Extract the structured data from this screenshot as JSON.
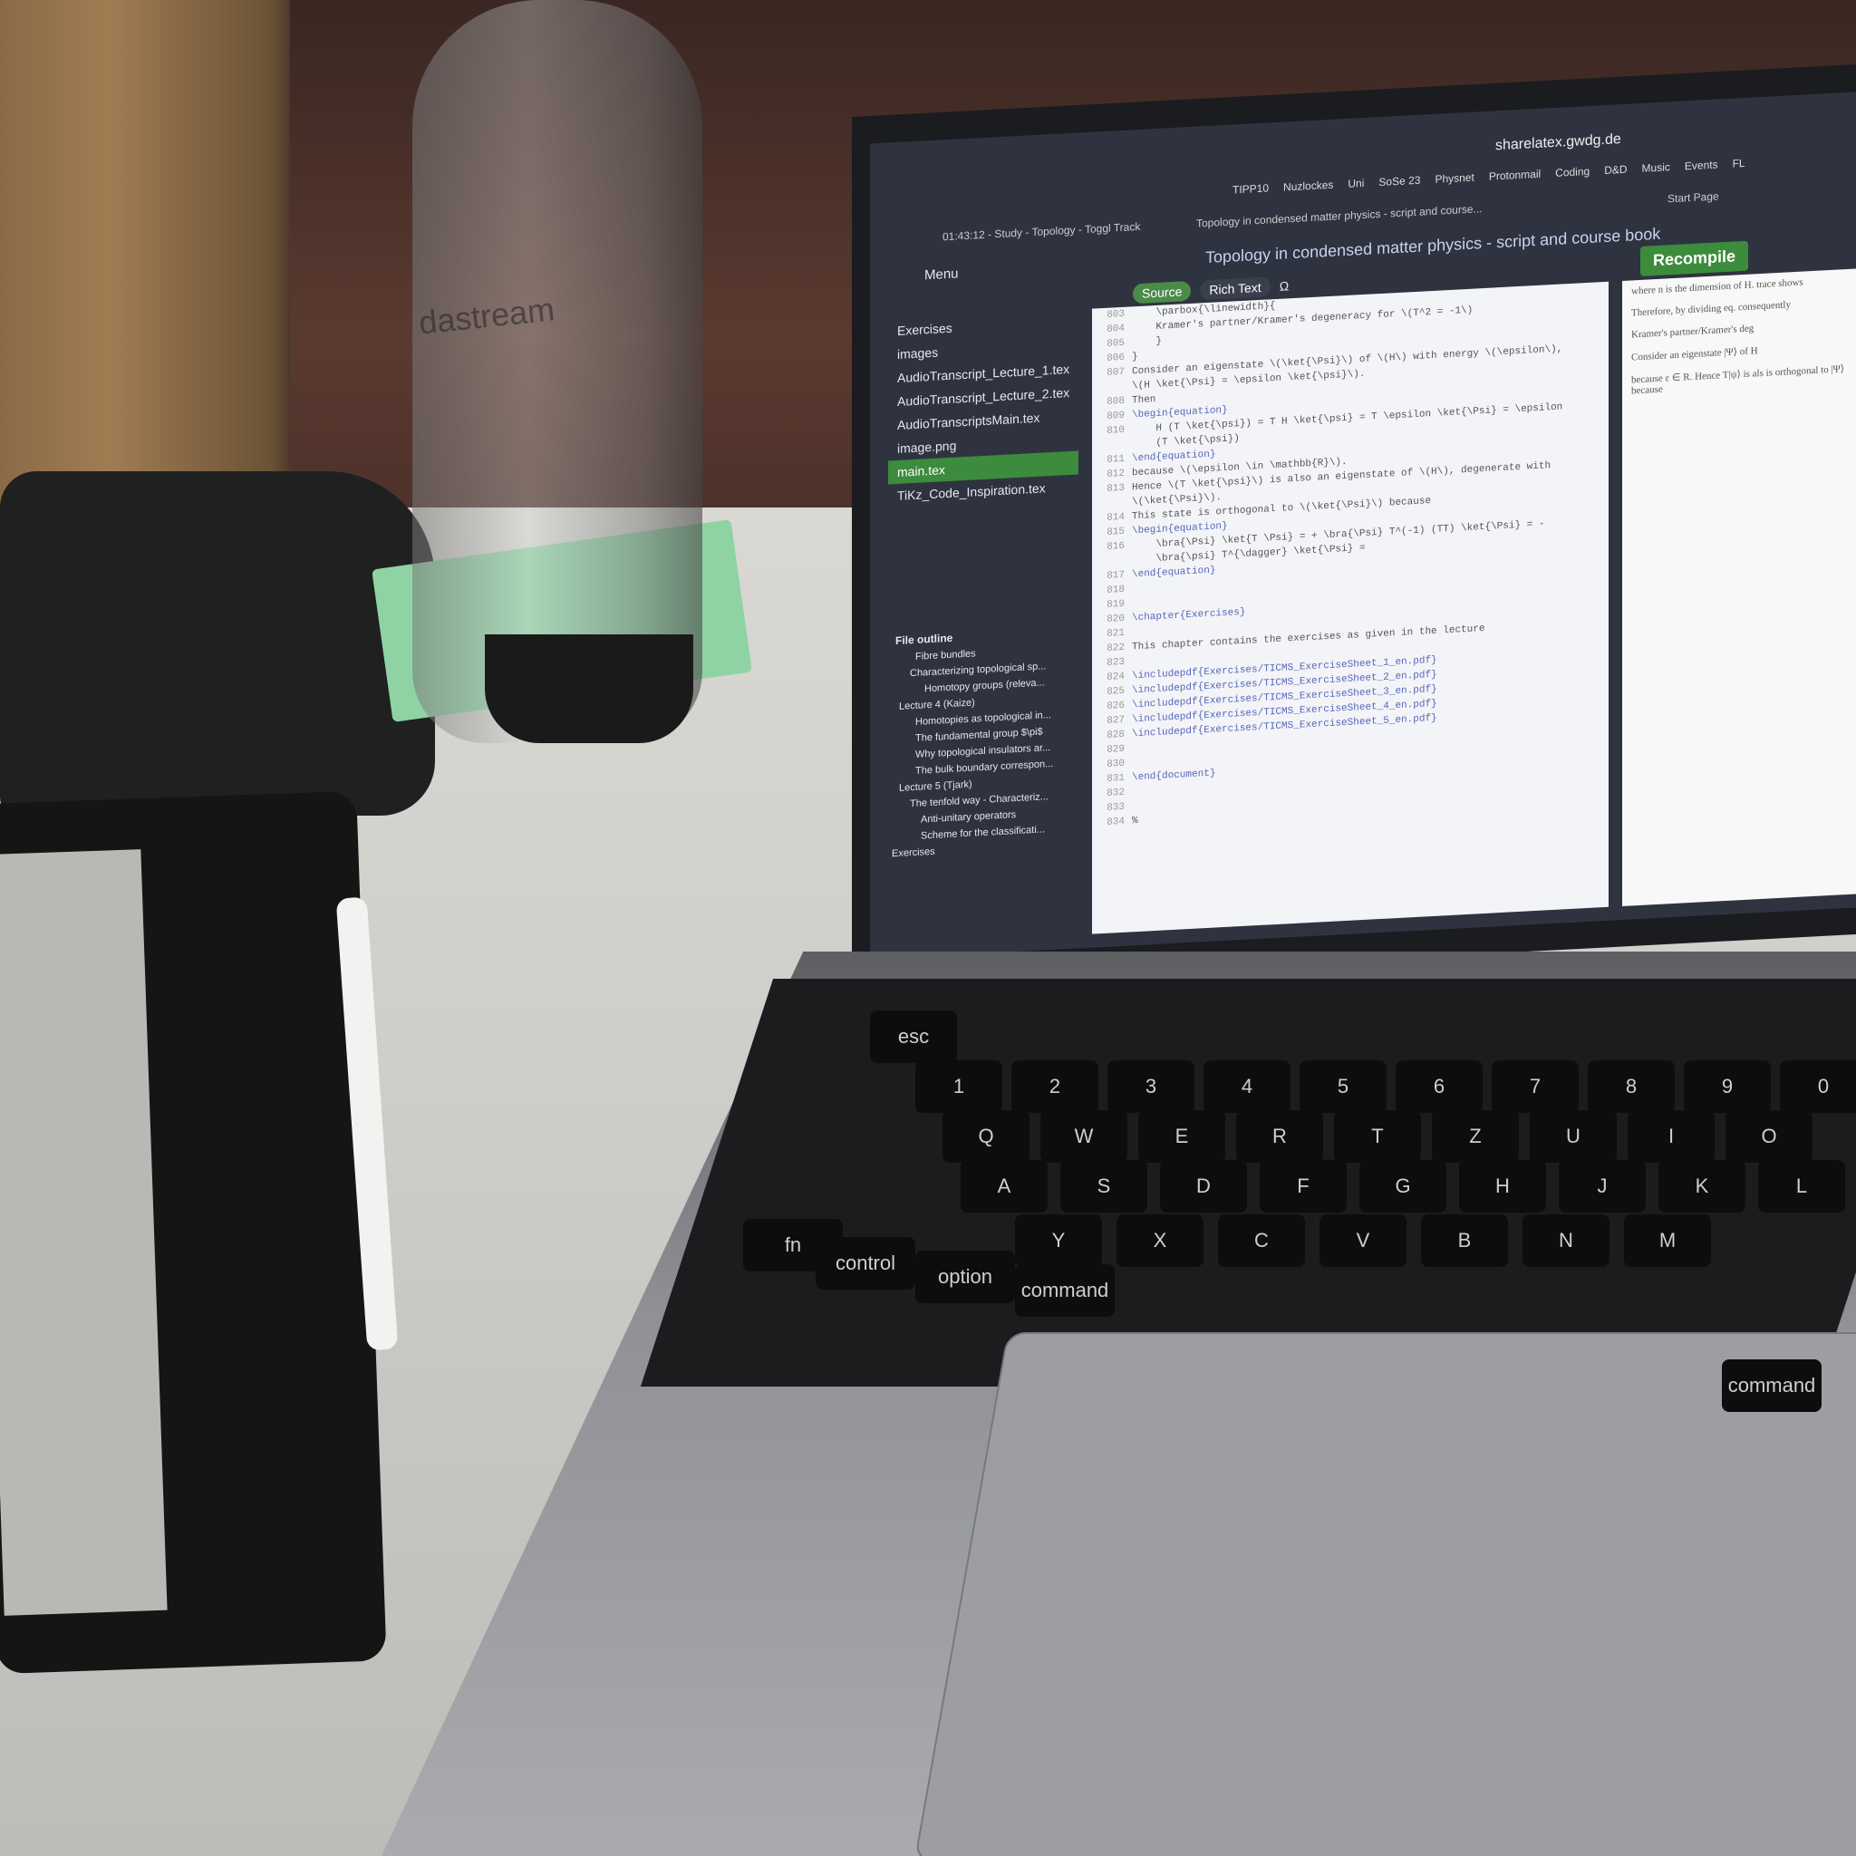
{
  "scene": {
    "bottle_brand": "dastream"
  },
  "browser": {
    "url": "sharelatex.gwdg.de",
    "bookmarks": [
      "TIPP10",
      "Nuzlockes",
      "Uni",
      "SoSe 23",
      "Physnet",
      "Protonmail",
      "Coding",
      "D&D",
      "Music",
      "Events",
      "FL"
    ],
    "tabs": [
      "01:43:12 - Study - Topology - Toggl Track",
      "Topology in condensed matter physics - script and course..."
    ],
    "start_page": "Start Page"
  },
  "editor": {
    "menu": "Menu",
    "title": "Topology in condensed matter physics - script and course book",
    "source": "Source",
    "rich_text": "Rich Text",
    "recompile": "Recompile"
  },
  "files": [
    "Exercises",
    "images",
    "AudioTranscript_Lecture_1.tex",
    "AudioTranscript_Lecture_2.tex",
    "AudioTranscriptsMain.tex",
    "image.png",
    "main.tex",
    "TiKz_Code_Inspiration.tex"
  ],
  "outline": {
    "header": "File outline",
    "items": [
      "Fibre bundles",
      "Characterizing topological sp...",
      "Homotopy groups (releva...",
      "Lecture 4 (Kaize)",
      "Homotopies as topological in...",
      "The fundamental group $\\pi$",
      "Why topological insulators ar...",
      "The bulk boundary correspon...",
      "Lecture 5 (Tjark)",
      "The tenfold way - Characteriz...",
      "Anti-unitary operators",
      "Scheme for the classificati...",
      "Exercises"
    ]
  },
  "code": [
    {
      "n": "803",
      "t": "    \\parbox{\\linewidth}{"
    },
    {
      "n": "804",
      "t": "    Kramer's partner/Kramer's degeneracy for \\(T^2 = -1\\)"
    },
    {
      "n": "805",
      "t": "    }"
    },
    {
      "n": "806",
      "t": "}"
    },
    {
      "n": "807",
      "t": "Consider an eigenstate \\(\\ket{\\Psi}\\) of \\(H\\) with energy \\(\\epsilon\\),"
    },
    {
      "n": "",
      "t": "\\(H \\ket{\\Psi} = \\epsilon \\ket{\\psi}\\)."
    },
    {
      "n": "808",
      "t": "Then"
    },
    {
      "n": "809",
      "t": "\\begin{equation}"
    },
    {
      "n": "810",
      "t": "    H (T \\ket{\\psi}) = T H \\ket{\\psi} = T \\epsilon \\ket{\\Psi} = \\epsilon"
    },
    {
      "n": "",
      "t": "    (T \\ket{\\psi})"
    },
    {
      "n": "811",
      "t": "\\end{equation}"
    },
    {
      "n": "812",
      "t": "because \\(\\epsilon \\in \\mathbb{R}\\)."
    },
    {
      "n": "813",
      "t": "Hence \\(T \\ket{\\psi}\\) is also an eigenstate of \\(H\\), degenerate with"
    },
    {
      "n": "",
      "t": "\\(\\ket{\\Psi}\\)."
    },
    {
      "n": "814",
      "t": "This state is orthogonal to \\(\\ket{\\Psi}\\) because"
    },
    {
      "n": "815",
      "t": "\\begin{equation}"
    },
    {
      "n": "816",
      "t": "    \\bra{\\Psi} \\ket{T \\Psi} = + \\bra{\\Psi} T^(-1) (TT) \\ket{\\Psi} = -"
    },
    {
      "n": "",
      "t": "    \\bra{\\psi} T^{\\dagger} \\ket{\\Psi} ="
    },
    {
      "n": "817",
      "t": "\\end{equation}"
    },
    {
      "n": "818",
      "t": ""
    },
    {
      "n": "819",
      "t": ""
    },
    {
      "n": "820",
      "t": "\\chapter{Exercises}"
    },
    {
      "n": "821",
      "t": ""
    },
    {
      "n": "822",
      "t": "This chapter contains the exercises as given in the lecture"
    },
    {
      "n": "823",
      "t": ""
    },
    {
      "n": "824",
      "t": "\\includepdf{Exercises/TICMS_ExerciseSheet_1_en.pdf}"
    },
    {
      "n": "825",
      "t": "\\includepdf{Exercises/TICMS_ExerciseSheet_2_en.pdf}"
    },
    {
      "n": "826",
      "t": "\\includepdf{Exercises/TICMS_ExerciseSheet_3_en.pdf}"
    },
    {
      "n": "827",
      "t": "\\includepdf{Exercises/TICMS_ExerciseSheet_4_en.pdf}"
    },
    {
      "n": "828",
      "t": "\\includepdf{Exercises/TICMS_ExerciseSheet_5_en.pdf}"
    },
    {
      "n": "829",
      "t": ""
    },
    {
      "n": "830",
      "t": ""
    },
    {
      "n": "831",
      "t": "\\end{document}"
    },
    {
      "n": "832",
      "t": ""
    },
    {
      "n": "833",
      "t": ""
    },
    {
      "n": "834",
      "t": "%"
    }
  ],
  "pdf": [
    "where n is the dimension of H. trace shows",
    "Therefore, by dividing eq. consequently",
    "Kramer's partner/Kramer's deg",
    "Consider an eigenstate |Ψ⟩ of H",
    "because ε ∈ R. Hence T|ψ⟩ is als is orthogonal to |Ψ⟩ because"
  ],
  "keys": [
    "esc",
    "1",
    "2",
    "3",
    "4",
    "5",
    "6",
    "7",
    "8",
    "9",
    "0",
    "Q",
    "W",
    "E",
    "R",
    "T",
    "Z",
    "U",
    "I",
    "O",
    "A",
    "S",
    "D",
    "F",
    "G",
    "H",
    "J",
    "K",
    "L",
    "Y",
    "X",
    "C",
    "V",
    "B",
    "N",
    "M",
    "fn",
    "control",
    "option",
    "command",
    "command"
  ]
}
